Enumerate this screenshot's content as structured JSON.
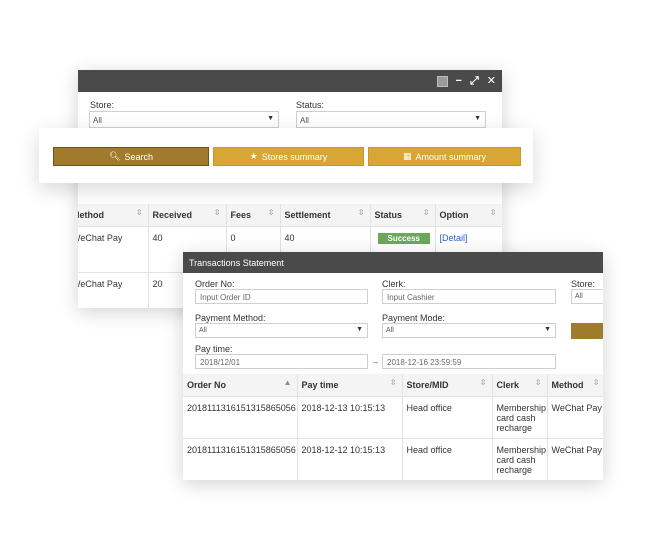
{
  "back_window": {
    "filters": {
      "store_label": "Store:",
      "store_value": "All",
      "status_label": "Status:",
      "status_value": "All"
    },
    "table": {
      "headers": [
        "Method",
        "Received",
        "Fees",
        "Settlement",
        "Status",
        "Option"
      ],
      "rows": [
        {
          "method": "WeChat Pay",
          "received": "40",
          "fees": "0",
          "settlement": "40",
          "status": "Success",
          "option": "[Detail]"
        },
        {
          "method": "WeChat Pay",
          "received": "20",
          "fees": "",
          "settlement": "",
          "status": "",
          "option": ""
        }
      ]
    }
  },
  "buttons": {
    "search": "Search",
    "stores_summary": "Stores summary",
    "amount_summary": "Amount summary"
  },
  "front_window": {
    "title": "Transactions Statement",
    "order_no_label": "Order No:",
    "order_no_placeholder": "Input Order ID",
    "clerk_label": "Clerk:",
    "clerk_placeholder": "Input Cashier",
    "store_label": "Store:",
    "store_value": "All",
    "payment_method_label": "Payment Method:",
    "payment_method_value": "All",
    "payment_mode_label": "Payment Mode:",
    "payment_mode_value": "All",
    "pay_time_label": "Pay time:",
    "pay_time_from": "2018/12/01",
    "pay_time_separator": "–",
    "pay_time_to": "2018-12-16 23:59:59",
    "table": {
      "headers": [
        "Order No",
        "Pay time",
        "Store/MID",
        "Clerk",
        "Method"
      ],
      "rows": [
        {
          "order_no": "201811131615131586505​6",
          "pay_time": "2018-12-13 10:15:13",
          "store": "Head office",
          "clerk": "Membership card cash recharge",
          "method": "WeChat Pay"
        },
        {
          "order_no": "201811131615131586505​6",
          "pay_time": "2018-12-12 10:15:13",
          "store": "Head office",
          "clerk": "Membership card cash recharge",
          "method": "WeChat Pay"
        }
      ]
    }
  },
  "colors": {
    "titlebar": "#4a4a4a",
    "gold_dark": "#a07b2c",
    "gold": "#d7a634",
    "success": "#6ca85c",
    "link": "#2a63b8"
  }
}
